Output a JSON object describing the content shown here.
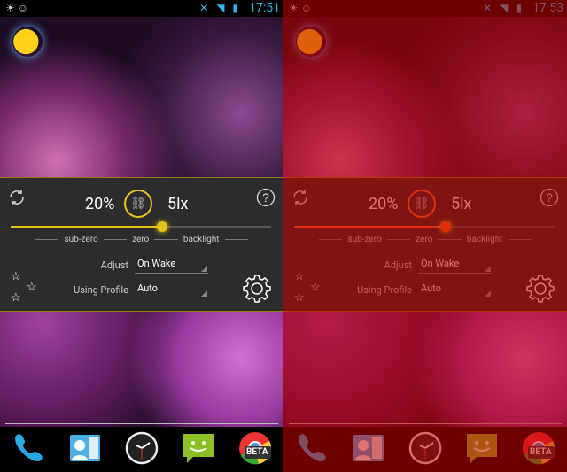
{
  "panels": [
    {
      "status": {
        "time": "17:51"
      },
      "widget": {
        "brightness": "20%",
        "lux": "5lx",
        "slider_level": 0.58,
        "scale": {
          "left": "sub-zero",
          "center": "zero",
          "right": "backlight"
        },
        "adjust_label": "Adjust",
        "adjust_value": "On Wake",
        "profile_label": "Using Profile",
        "profile_value": "Auto"
      },
      "dock": {
        "chrome_badge": "BETA"
      },
      "accent": "#e8c21a",
      "tinted": false
    },
    {
      "status": {
        "time": "17:53"
      },
      "widget": {
        "brightness": "20%",
        "lux": "5lx",
        "slider_level": 0.58,
        "scale": {
          "left": "sub-zero",
          "center": "zero",
          "right": "backlight"
        },
        "adjust_label": "Adjust",
        "adjust_value": "On Wake",
        "profile_label": "Using Profile",
        "profile_value": "Auto"
      },
      "dock": {
        "chrome_badge": "BETA"
      },
      "accent": "#ff6a10",
      "tinted": true
    }
  ],
  "icons": [
    "refresh-icon",
    "chain-link-icon",
    "help-icon",
    "stars-icon",
    "gear-icon",
    "phone-icon",
    "contacts-icon",
    "clock-icon",
    "messaging-icon",
    "chrome-beta-icon"
  ]
}
